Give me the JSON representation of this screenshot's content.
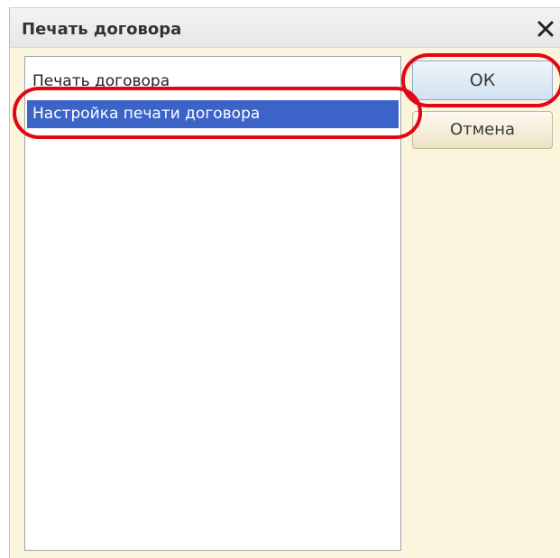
{
  "dialog": {
    "title": "Печать договора",
    "close_icon": "close-icon",
    "close_symbol": "✕"
  },
  "list": {
    "items": [
      {
        "label": "Печать договора",
        "selected": false
      },
      {
        "label": "Настройка печати договора",
        "selected": true
      }
    ]
  },
  "buttons": {
    "ok_label": "ОК",
    "cancel_label": "Отмена"
  },
  "colors": {
    "dialog_background": "#fbf5dd",
    "selection_background": "#3c64c8",
    "annotation_red": "#e30613",
    "ok_button": "#d2e1f1"
  },
  "annotations": {
    "highlighted_targets": [
      "ok-button",
      "list-item-print-settings"
    ]
  }
}
